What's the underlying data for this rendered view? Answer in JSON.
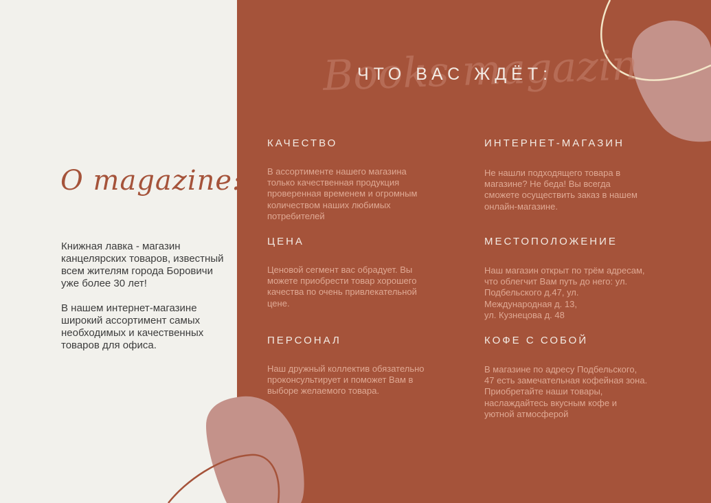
{
  "left": {
    "title": "O magazine:",
    "paragraphs": [
      "Книжная лавка - магазин канцелярских товаров, известный всем жителям города Боровичи уже более 30 лет!",
      "В нашем интернет-магазине широкий ассортимент самых необходимых и качественных товаров для офиса."
    ]
  },
  "right": {
    "watermark": "Books magazin",
    "heading": "ЧТО ВАС ЖДЁТ:",
    "sections": [
      {
        "title": "КАЧЕСТВО",
        "lines": [
          "В ассортименте нашего магазина",
          "только качественная продукция",
          "проверенная временем и огромным",
          "количеством наших любимых",
          "потребителей"
        ]
      },
      {
        "title": "ИНТЕРНЕТ-МАГАЗИН",
        "lines": [
          "Не нашли подходящего товара в",
          "магазине? Не беда! Вы всегда",
          "сможете осуществить заказ в нашем",
          "онлайн-магазине."
        ]
      },
      {
        "title": "ЦЕНА",
        "lines": [
          "Ценовой сегмент вас обрадует. Вы",
          "можете приобрести товар хорошего",
          "качества по очень привлекательной",
          "цене."
        ]
      },
      {
        "title": "МЕСТОПОЛОЖЕНИЕ",
        "lines": [
          "Наш магазин открыт по трём адресам,",
          "что облегчит Вам путь до него: ул.",
          "Подбельского д.47, ул.",
          "Международная д. 13,",
          "ул.  Кузнецова д. 48"
        ]
      },
      {
        "title": "ПЕРСОНАЛ",
        "lines": [
          "Наш дружный коллектив обязательно",
          "проконсультирует и поможет Вам в",
          "выборе желаемого товара."
        ]
      },
      {
        "title": "КОФЕ С СОБОЙ",
        "lines": [
          "В магазине по адресу Подбельского,",
          "47 есть замечательная кофейная зона.",
          "Приобретайте наши товары,",
          "наслаждайтесь вкусным кофе и",
          "уютной атмосферой"
        ]
      }
    ]
  },
  "colors": {
    "panel": "#a5533a",
    "background": "#f2f1ec",
    "blob": "#c4928a",
    "line": "#f3e6c8"
  }
}
